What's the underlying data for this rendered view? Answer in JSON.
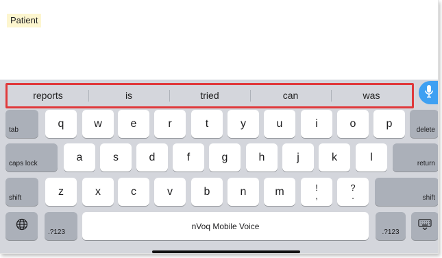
{
  "editor": {
    "text": "Patient"
  },
  "predictions": [
    "reports",
    "is",
    "tried",
    "can",
    "was"
  ],
  "colors": {
    "highlight_border": "#e0393b",
    "mic": "#3fa0f2",
    "keyboard_bg": "#d4d6dc"
  },
  "keys": {
    "tab": "tab",
    "row1": [
      "q",
      "w",
      "e",
      "r",
      "t",
      "y",
      "u",
      "i",
      "o",
      "p"
    ],
    "delete": "delete",
    "caps_lock": "caps lock",
    "row2": [
      "a",
      "s",
      "d",
      "f",
      "g",
      "h",
      "j",
      "k",
      "l"
    ],
    "return": "return",
    "shift_left": "shift",
    "row3": [
      "z",
      "x",
      "c",
      "v",
      "b",
      "n",
      "m"
    ],
    "exclaim": [
      "!",
      ","
    ],
    "question": [
      "?",
      "."
    ],
    "shift_right": "shift",
    "numbers_left": ".?123",
    "space": "nVoq Mobile Voice",
    "numbers_right": ".?123"
  },
  "icons": [
    "microphone-icon",
    "globe-icon",
    "keyboard-dismiss-icon"
  ]
}
